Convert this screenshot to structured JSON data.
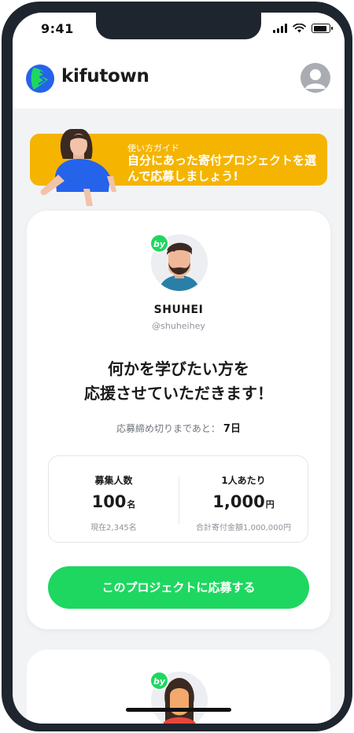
{
  "status_bar": {
    "time": "9:41",
    "battery_level": 0.9
  },
  "header": {
    "logo_text": "kifutown",
    "brand_color": "#1ed760",
    "logo_blue": "#2563eb"
  },
  "guide": {
    "label": "使い方ガイド",
    "text": "自分にあった寄付プロジェクトを選んで応募しましょう!",
    "color": "#f5b400"
  },
  "project": {
    "badge": "by",
    "username": "SHUHEI",
    "handle": "@shuheihey",
    "title_line1": "何かを学びたい方を",
    "title_line2": "応援させていただきます！",
    "deadline_label": "応募締め切りまであと：",
    "deadline_value": "7日",
    "stats": {
      "recruit_label": "募集人数",
      "recruit_value": "100",
      "recruit_unit": "名",
      "recruit_current": "現在2,345名",
      "per_person_label": "1人あたり",
      "per_person_value": "1,000",
      "per_person_unit": "円",
      "total_amount": "合計寄付金額1,000,000円"
    },
    "apply_label": "このプロジェクトに応募する"
  },
  "next_project": {
    "badge": "by"
  },
  "icons": [
    "signal-icon",
    "wifi-icon",
    "battery-icon",
    "user-icon",
    "logo-icon"
  ]
}
